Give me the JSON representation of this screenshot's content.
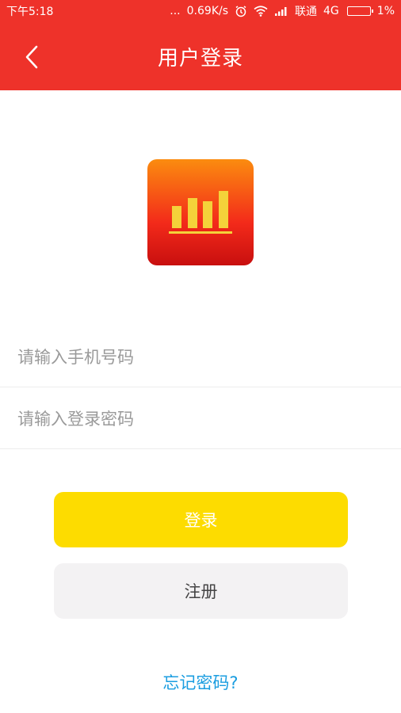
{
  "status_bar": {
    "time": "下午5:18",
    "dots": "...",
    "speed": "0.69K/s",
    "carrier": "联通",
    "network": "4G",
    "battery": "1%"
  },
  "header": {
    "title": "用户登录",
    "color": "#ee322a"
  },
  "form": {
    "phone_placeholder": "请输入手机号码",
    "password_placeholder": "请输入登录密码"
  },
  "buttons": {
    "login_label": "登录",
    "register_label": "注册",
    "login_color": "#fddc00"
  },
  "links": {
    "forgot_password": "忘记密码?"
  }
}
